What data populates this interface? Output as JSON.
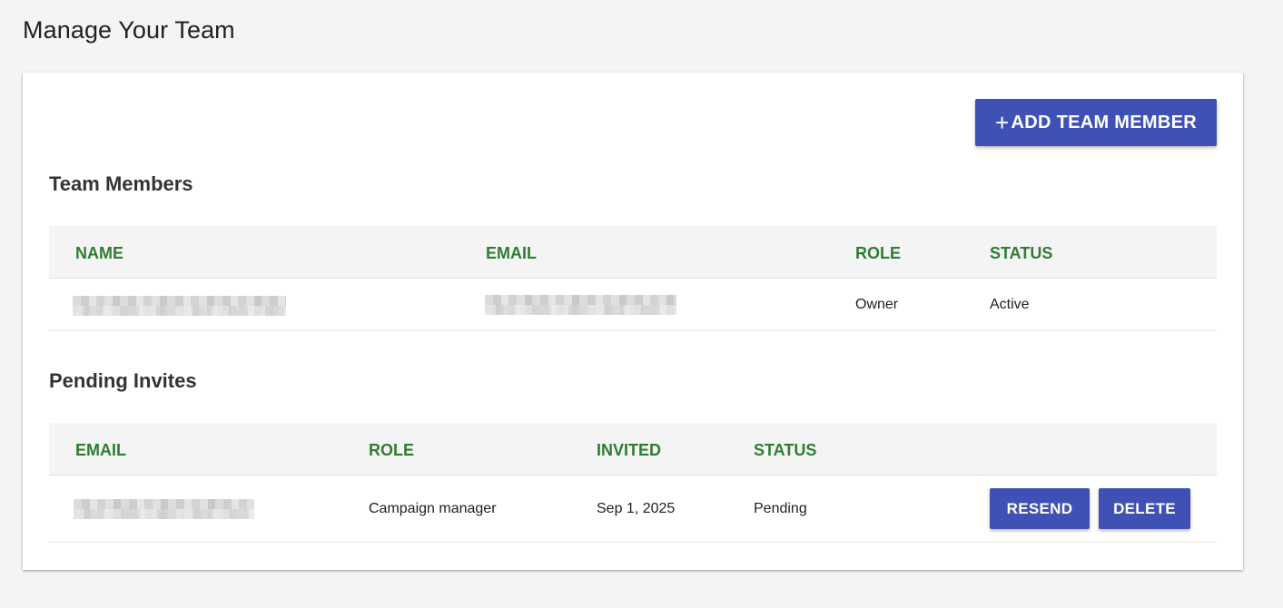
{
  "page": {
    "title": "Manage Your Team"
  },
  "toolbar": {
    "add_icon": "plus-icon",
    "add_label": "ADD TEAM MEMBER"
  },
  "team_members": {
    "title": "Team Members",
    "columns": [
      "NAME",
      "EMAIL",
      "ROLE",
      "STATUS"
    ],
    "rows": [
      {
        "name": "",
        "email": "",
        "role": "Owner",
        "status": "Active"
      }
    ]
  },
  "pending_invites": {
    "title": "Pending Invites",
    "columns": [
      "EMAIL",
      "ROLE",
      "INVITED",
      "STATUS"
    ],
    "rows": [
      {
        "email": "",
        "role": "Campaign manager",
        "invited": "Sep 1, 2025",
        "status": "Pending",
        "resend_label": "RESEND",
        "delete_label": "DELETE"
      }
    ]
  },
  "colors": {
    "primary": "#3f51b5",
    "header_text": "#2e7d32",
    "background": "#f4f4f4"
  }
}
